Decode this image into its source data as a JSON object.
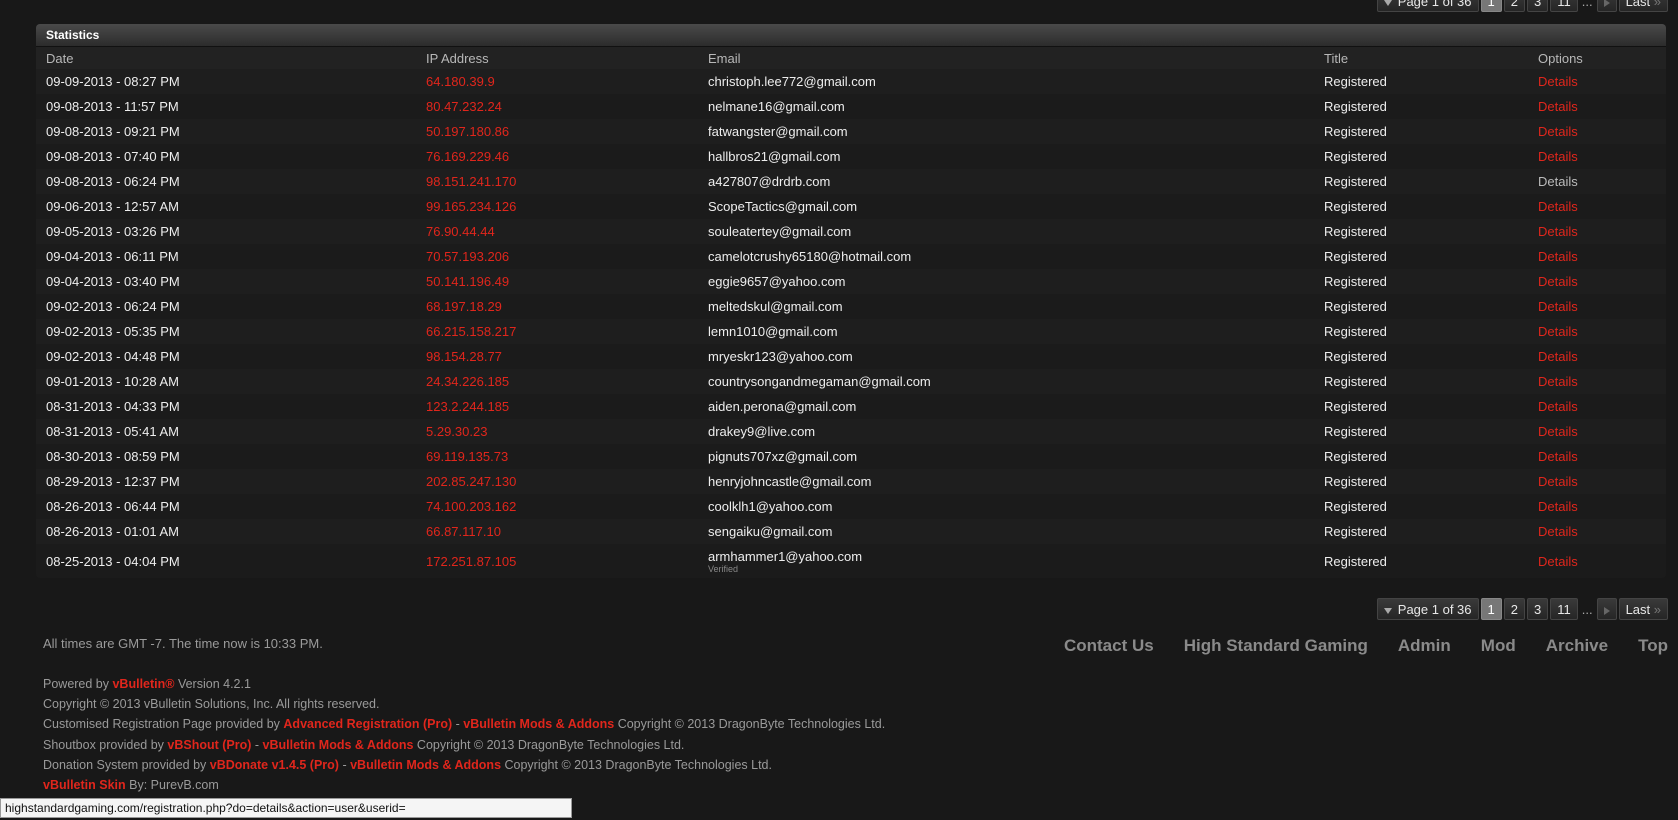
{
  "pager": {
    "page_label": "Page 1 of 36",
    "pages": [
      "1",
      "2",
      "3",
      "11"
    ],
    "dots": "...",
    "last_label": "Last"
  },
  "stats": {
    "title": "Statistics",
    "columns": [
      "Date",
      "IP Address",
      "Email",
      "Title",
      "Options"
    ],
    "rows": [
      {
        "date": "09-09-2013 - 08:27 PM",
        "ip": "64.180.39.9",
        "email": "christoph.lee772@gmail.com",
        "title": "Registered",
        "option": "Details"
      },
      {
        "date": "09-08-2013 - 11:57 PM",
        "ip": "80.47.232.24",
        "email": "nelmane16@gmail.com",
        "title": "Registered",
        "option": "Details"
      },
      {
        "date": "09-08-2013 - 09:21 PM",
        "ip": "50.197.180.86",
        "email": "fatwangster@gmail.com",
        "title": "Registered",
        "option": "Details"
      },
      {
        "date": "09-08-2013 - 07:40 PM",
        "ip": "76.169.229.46",
        "email": "hallbros21@gmail.com",
        "title": "Registered",
        "option": "Details"
      },
      {
        "date": "09-08-2013 - 06:24 PM",
        "ip": "98.151.241.170",
        "email": "a427807@drdrb.com",
        "title": "Registered",
        "option": "Details"
      },
      {
        "date": "09-06-2013 - 12:57 AM",
        "ip": "99.165.234.126",
        "email": "ScopeTactics@gmail.com",
        "title": "Registered",
        "option": "Details"
      },
      {
        "date": "09-05-2013 - 03:26 PM",
        "ip": "76.90.44.44",
        "email": "souleatertey@gmail.com",
        "title": "Registered",
        "option": "Details"
      },
      {
        "date": "09-04-2013 - 06:11 PM",
        "ip": "70.57.193.206",
        "email": "camelotcrushy65180@hotmail.com",
        "title": "Registered",
        "option": "Details"
      },
      {
        "date": "09-04-2013 - 03:40 PM",
        "ip": "50.141.196.49",
        "email": "eggie9657@yahoo.com",
        "title": "Registered",
        "option": "Details"
      },
      {
        "date": "09-02-2013 - 06:24 PM",
        "ip": "68.197.18.29",
        "email": "meltedskul@gmail.com",
        "title": "Registered",
        "option": "Details"
      },
      {
        "date": "09-02-2013 - 05:35 PM",
        "ip": "66.215.158.217",
        "email": "lemn1010@gmail.com",
        "title": "Registered",
        "option": "Details"
      },
      {
        "date": "09-02-2013 - 04:48 PM",
        "ip": "98.154.28.77",
        "email": "mryeskr123@yahoo.com",
        "title": "Registered",
        "option": "Details"
      },
      {
        "date": "09-01-2013 - 10:28 AM",
        "ip": "24.34.226.185",
        "email": "countrysongandmegaman@gmail.com",
        "title": "Registered",
        "option": "Details"
      },
      {
        "date": "08-31-2013 - 04:33 PM",
        "ip": "123.2.244.185",
        "email": "aiden.perona@gmail.com",
        "title": "Registered",
        "option": "Details"
      },
      {
        "date": "08-31-2013 - 05:41 AM",
        "ip": "5.29.30.23",
        "email": "drakey9@live.com",
        "title": "Registered",
        "option": "Details"
      },
      {
        "date": "08-30-2013 - 08:59 PM",
        "ip": "69.119.135.73",
        "email": "pignuts707xz@gmail.com",
        "title": "Registered",
        "option": "Details"
      },
      {
        "date": "08-29-2013 - 12:37 PM",
        "ip": "202.85.247.130",
        "email": "henryjohncastle@gmail.com",
        "title": "Registered",
        "option": "Details"
      },
      {
        "date": "08-26-2013 - 06:44 PM",
        "ip": "74.100.203.162",
        "email": "coolklh1@yahoo.com",
        "title": "Registered",
        "option": "Details"
      },
      {
        "date": "08-26-2013 - 01:01 AM",
        "ip": "66.87.117.10",
        "email": "sengaiku@gmail.com",
        "title": "Registered",
        "option": "Details"
      },
      {
        "date": "08-25-2013 - 04:04 PM",
        "ip": "172.251.87.105",
        "email": "armhammer1@yahoo.com",
        "email_note": "Verified",
        "title": "Registered",
        "option": "Details"
      }
    ]
  },
  "footer": {
    "timezone": "All times are GMT -7. The time now is 10:33 PM.",
    "links": [
      "Contact Us",
      "High Standard Gaming",
      "Admin",
      "Mod",
      "Archive",
      "Top"
    ],
    "powered_prefix": "Powered by ",
    "powered_link": "vBulletin®",
    "powered_suffix": " Version 4.2.1",
    "copyright": "Copyright © 2013 vBulletin Solutions, Inc. All rights reserved.",
    "reg_prefix": "Customised Registration Page provided by ",
    "reg_link": "Advanced Registration (Pro)",
    "sep": " - ",
    "mods_link": "vBulletin Mods & Addons",
    "dragon_copyright": " Copyright © 2013 DragonByte Technologies Ltd.",
    "shout_prefix": "Shoutbox provided by ",
    "shout_link": "vBShout (Pro)",
    "donate_prefix": "Donation System provided by ",
    "donate_link": "vBDonate v1.4.5 (Pro)",
    "skin_link": "vBulletin Skin",
    "skin_suffix": " By: PurevB.com"
  },
  "statusbar": {
    "url": "highstandardgaming.com/registration.php?do=details&action=user&userid="
  },
  "colors": {
    "accent_red": "#e0261c",
    "background": "#181818"
  }
}
